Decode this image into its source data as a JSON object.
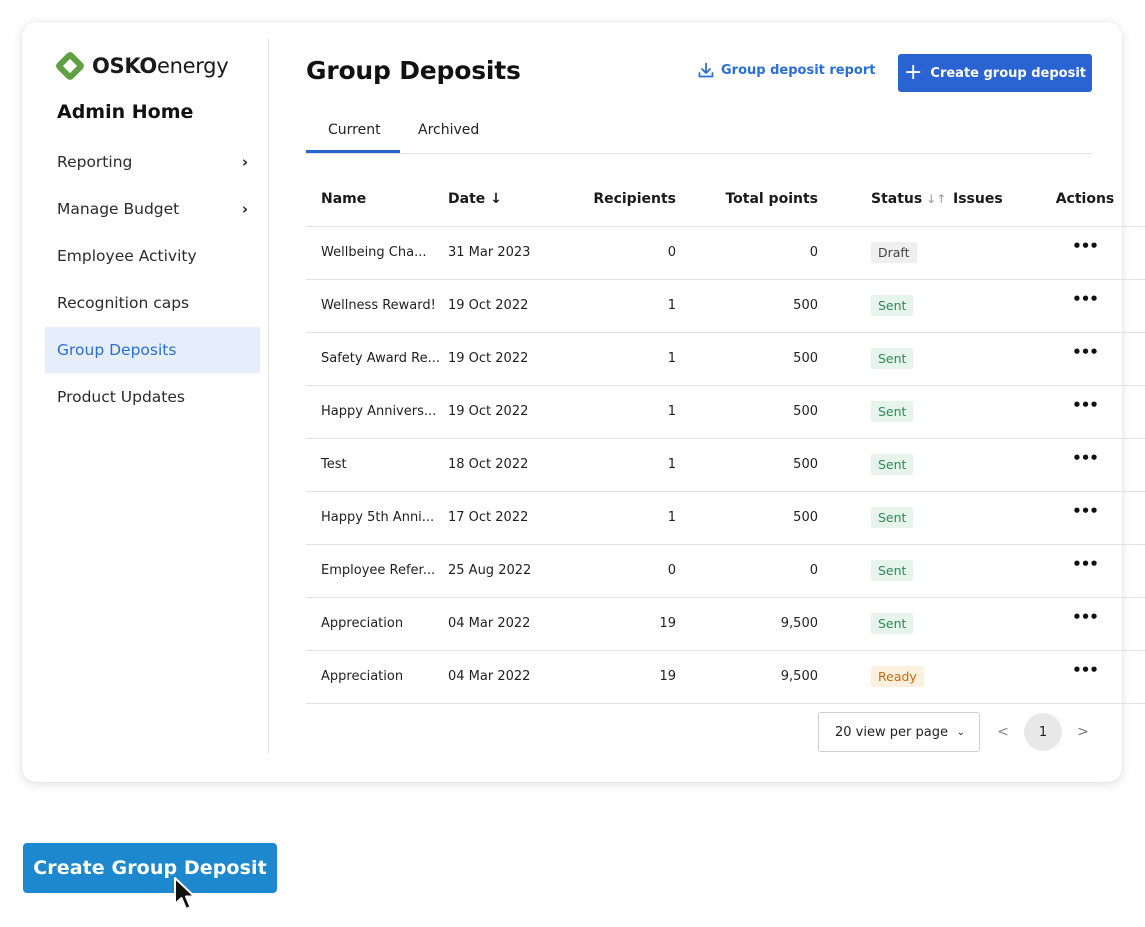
{
  "brand": {
    "name_bold": "OSKO",
    "name_light": "energy",
    "accent": "#5fa043"
  },
  "sidebar": {
    "title": "Admin Home",
    "items": [
      {
        "label": "Reporting",
        "has_submenu": true
      },
      {
        "label": "Manage Budget",
        "has_submenu": true
      },
      {
        "label": "Employee Activity"
      },
      {
        "label": "Recognition caps"
      },
      {
        "label": "Group Deposits",
        "active": true
      },
      {
        "label": "Product Updates"
      }
    ],
    "submenu_icon": "chevron-right-icon"
  },
  "header": {
    "title": "Group Deposits",
    "report_label": "Group deposit report",
    "report_icon": "download-icon",
    "create_label": "Create group deposit",
    "create_icon": "plus-icon"
  },
  "tabs": [
    {
      "label": "Current",
      "active": true
    },
    {
      "label": "Archived"
    }
  ],
  "table": {
    "columns": [
      "Name",
      "Date ↓",
      "Recipients",
      "Total points",
      "Status",
      "Issues",
      "Actions"
    ],
    "rows": [
      {
        "name": "Wellbeing Cha...",
        "date": "31 Mar 2023",
        "recipients": "0",
        "points": "0",
        "status": "Draft"
      },
      {
        "name": "Wellness Reward!",
        "date": "19 Oct 2022",
        "recipients": "1",
        "points": "500",
        "status": "Sent"
      },
      {
        "name": "Safety Award Re...",
        "date": "19 Oct 2022",
        "recipients": "1",
        "points": "500",
        "status": "Sent"
      },
      {
        "name": "Happy Annivers...",
        "date": "19 Oct 2022",
        "recipients": "1",
        "points": "500",
        "status": "Sent"
      },
      {
        "name": "Test",
        "date": "18 Oct 2022",
        "recipients": "1",
        "points": "500",
        "status": "Sent"
      },
      {
        "name": "Happy 5th Anni...",
        "date": "17 Oct 2022",
        "recipients": "1",
        "points": "500",
        "status": "Sent"
      },
      {
        "name": "Employee Refer...",
        "date": "25 Aug 2022",
        "recipients": "0",
        "points": "0",
        "status": "Sent"
      },
      {
        "name": "Appreciation",
        "date": "04 Mar 2022",
        "recipients": "19",
        "points": "9,500",
        "status": "Sent"
      },
      {
        "name": "Appreciation",
        "date": "04 Mar 2022",
        "recipients": "19",
        "points": "9,500",
        "status": "Ready"
      }
    ],
    "actions_label": "•••"
  },
  "pagination": {
    "per_page_label": "20 view per page",
    "current_page": "1",
    "prev_label": "<",
    "next_label": ">"
  },
  "cta": {
    "label": "Create Group Deposit"
  },
  "colors": {
    "primary": "#2a64d3",
    "cta": "#1e88cf",
    "sent": "#2f8a55",
    "ready": "#c66a12"
  }
}
